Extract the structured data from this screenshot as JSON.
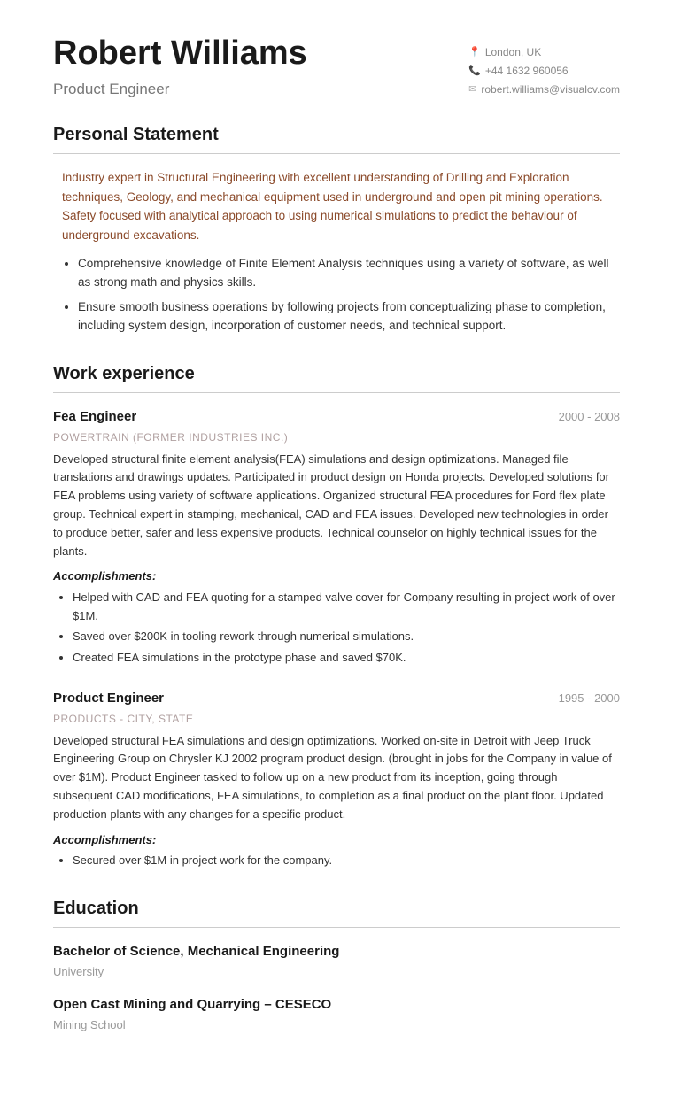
{
  "header": {
    "name": "Robert Williams",
    "job_title": "Product Engineer",
    "contact": {
      "location": "London, UK",
      "phone": "+44 1632 960056",
      "email": "robert.williams@visualcv.com"
    }
  },
  "sections": {
    "personal_statement": {
      "title": "Personal Statement",
      "intro": "Industry expert in Structural Engineering with excellent understanding of Drilling and Exploration techniques, Geology, and mechanical equipment used in underground and open pit mining operations. Safety focused with analytical approach to using numerical simulations to predict the behaviour of underground excavations.",
      "bullets": [
        "Comprehensive knowledge of Finite Element Analysis techniques using a variety of software, as well as strong math and physics skills.",
        "Ensure smooth business operations by following projects from conceptualizing phase to completion, including system design, incorporation of customer needs, and technical support."
      ]
    },
    "work_experience": {
      "title": "Work experience",
      "jobs": [
        {
          "title": "Fea Engineer",
          "dates": "2000 - 2008",
          "company": "POWERTRAIN (FORMER INDUSTRIES INC.)",
          "description": "Developed structural finite element analysis(FEA) simulations and design optimizations. Managed file translations and drawings updates. Participated in product design on Honda projects. Developed solutions for FEA problems using variety of software applications. Organized structural FEA procedures for Ford flex plate group. Technical expert in stamping, mechanical, CAD and FEA issues. Developed new technologies in order to produce better, safer and less expensive products. Technical counselor on highly technical issues for the plants.",
          "accomplishments_label": "Accomplishments:",
          "accomplishments": [
            "Helped with CAD and FEA quoting for a stamped valve cover for Company resulting in project work of over $1M.",
            "Saved over $200K in tooling rework through numerical simulations.",
            "Created FEA simulations in the prototype phase and saved $70K."
          ]
        },
        {
          "title": "Product Engineer",
          "dates": "1995 - 2000",
          "company": "PRODUCTS - CITY, STATE",
          "description": "Developed structural FEA simulations and design optimizations. Worked on-site in Detroit with Jeep Truck Engineering Group on Chrysler KJ 2002 program product design. (brought in jobs for the Company in value of over $1M). Product Engineer tasked to follow up on a new product from its inception, going through subsequent CAD modifications, FEA simulations, to completion as a final product on the plant floor. Updated production plants with any changes for a specific product.",
          "accomplishments_label": "Accomplishments:",
          "accomplishments": [
            "Secured over $1M in project work for the company."
          ]
        }
      ]
    },
    "education": {
      "title": "Education",
      "entries": [
        {
          "degree": "Bachelor of Science, Mechanical Engineering",
          "institution": "University"
        },
        {
          "degree": "Open Cast Mining and Quarrying – CESECO",
          "institution": "Mining School"
        }
      ]
    }
  }
}
